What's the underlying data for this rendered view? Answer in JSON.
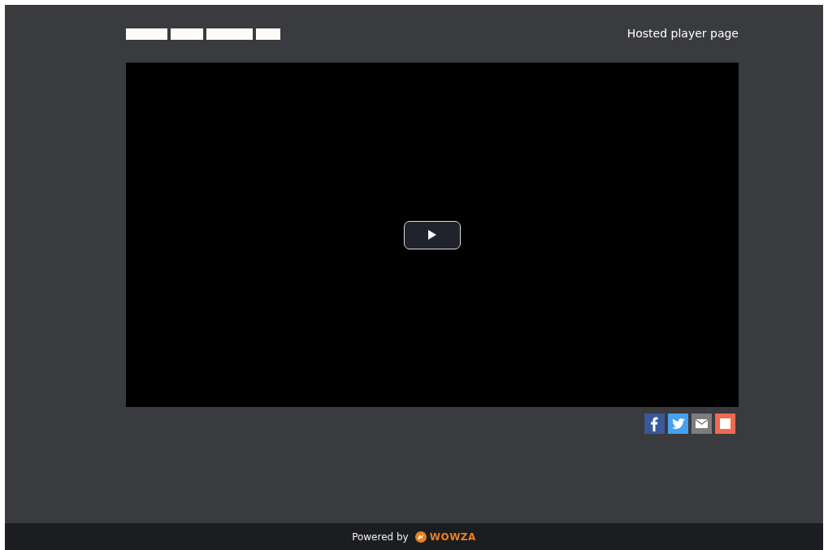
{
  "header": {
    "title": "Hosted player page"
  },
  "player": {
    "play_button": true
  },
  "share_buttons": [
    {
      "kind": "facebook"
    },
    {
      "kind": "twitter"
    },
    {
      "kind": "email"
    },
    {
      "kind": "other"
    }
  ],
  "footer": {
    "powered_by": "Powered by",
    "brand": "WOWZA"
  }
}
